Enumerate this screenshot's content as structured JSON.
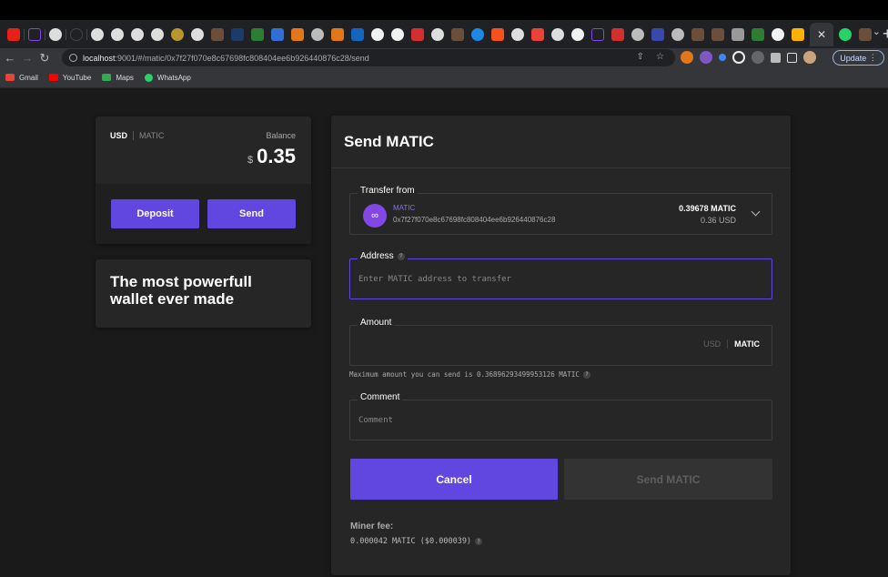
{
  "browser": {
    "url_host": "localhost",
    "url_path": ":9001/#/matic/0x7f27f070e8c67698fc808404ee6b926440876c28/send",
    "update_label": "Update",
    "bookmarks": [
      {
        "label": "Gmail",
        "color": "#ea4335"
      },
      {
        "label": "YouTube",
        "color": "#ff0000"
      },
      {
        "label": "Maps",
        "color": "#34a853"
      },
      {
        "label": "WhatsApp",
        "color": "#25d366"
      }
    ]
  },
  "wallet": {
    "currency_active": "USD",
    "currency_inactive": "MATIC",
    "balance_label": "Balance",
    "balance_symbol": "$",
    "balance_value": "0.35",
    "deposit_label": "Deposit",
    "send_label": "Send"
  },
  "promo": {
    "text": "The most powerfull wallet ever made"
  },
  "send": {
    "title": "Send MATIC",
    "from": {
      "legend": "Transfer from",
      "coin": "MATIC",
      "address": "0x7f27f070e8c67698fc808404ee6b926440876c28",
      "amount": "0.39678 MATIC",
      "usd": "0.36 USD"
    },
    "address": {
      "legend": "Address",
      "placeholder": "Enter MATIC address to transfer"
    },
    "amount": {
      "legend": "Amount",
      "unit_inactive": "USD",
      "unit_active": "MATIC",
      "hint": "Maximum amount you can send is 0.36896293499953126 MATIC"
    },
    "comment": {
      "legend": "Comment",
      "placeholder": "Comment"
    },
    "cancel_label": "Cancel",
    "submit_label": "Send MATIC",
    "fee_label": "Miner fee:",
    "fee_value": "0.000042 MATIC ($0.000039)"
  },
  "colors": {
    "accent": "#6146e0",
    "matic": "#8247e5",
    "background": "#1a1a1a",
    "card": "#262626"
  }
}
